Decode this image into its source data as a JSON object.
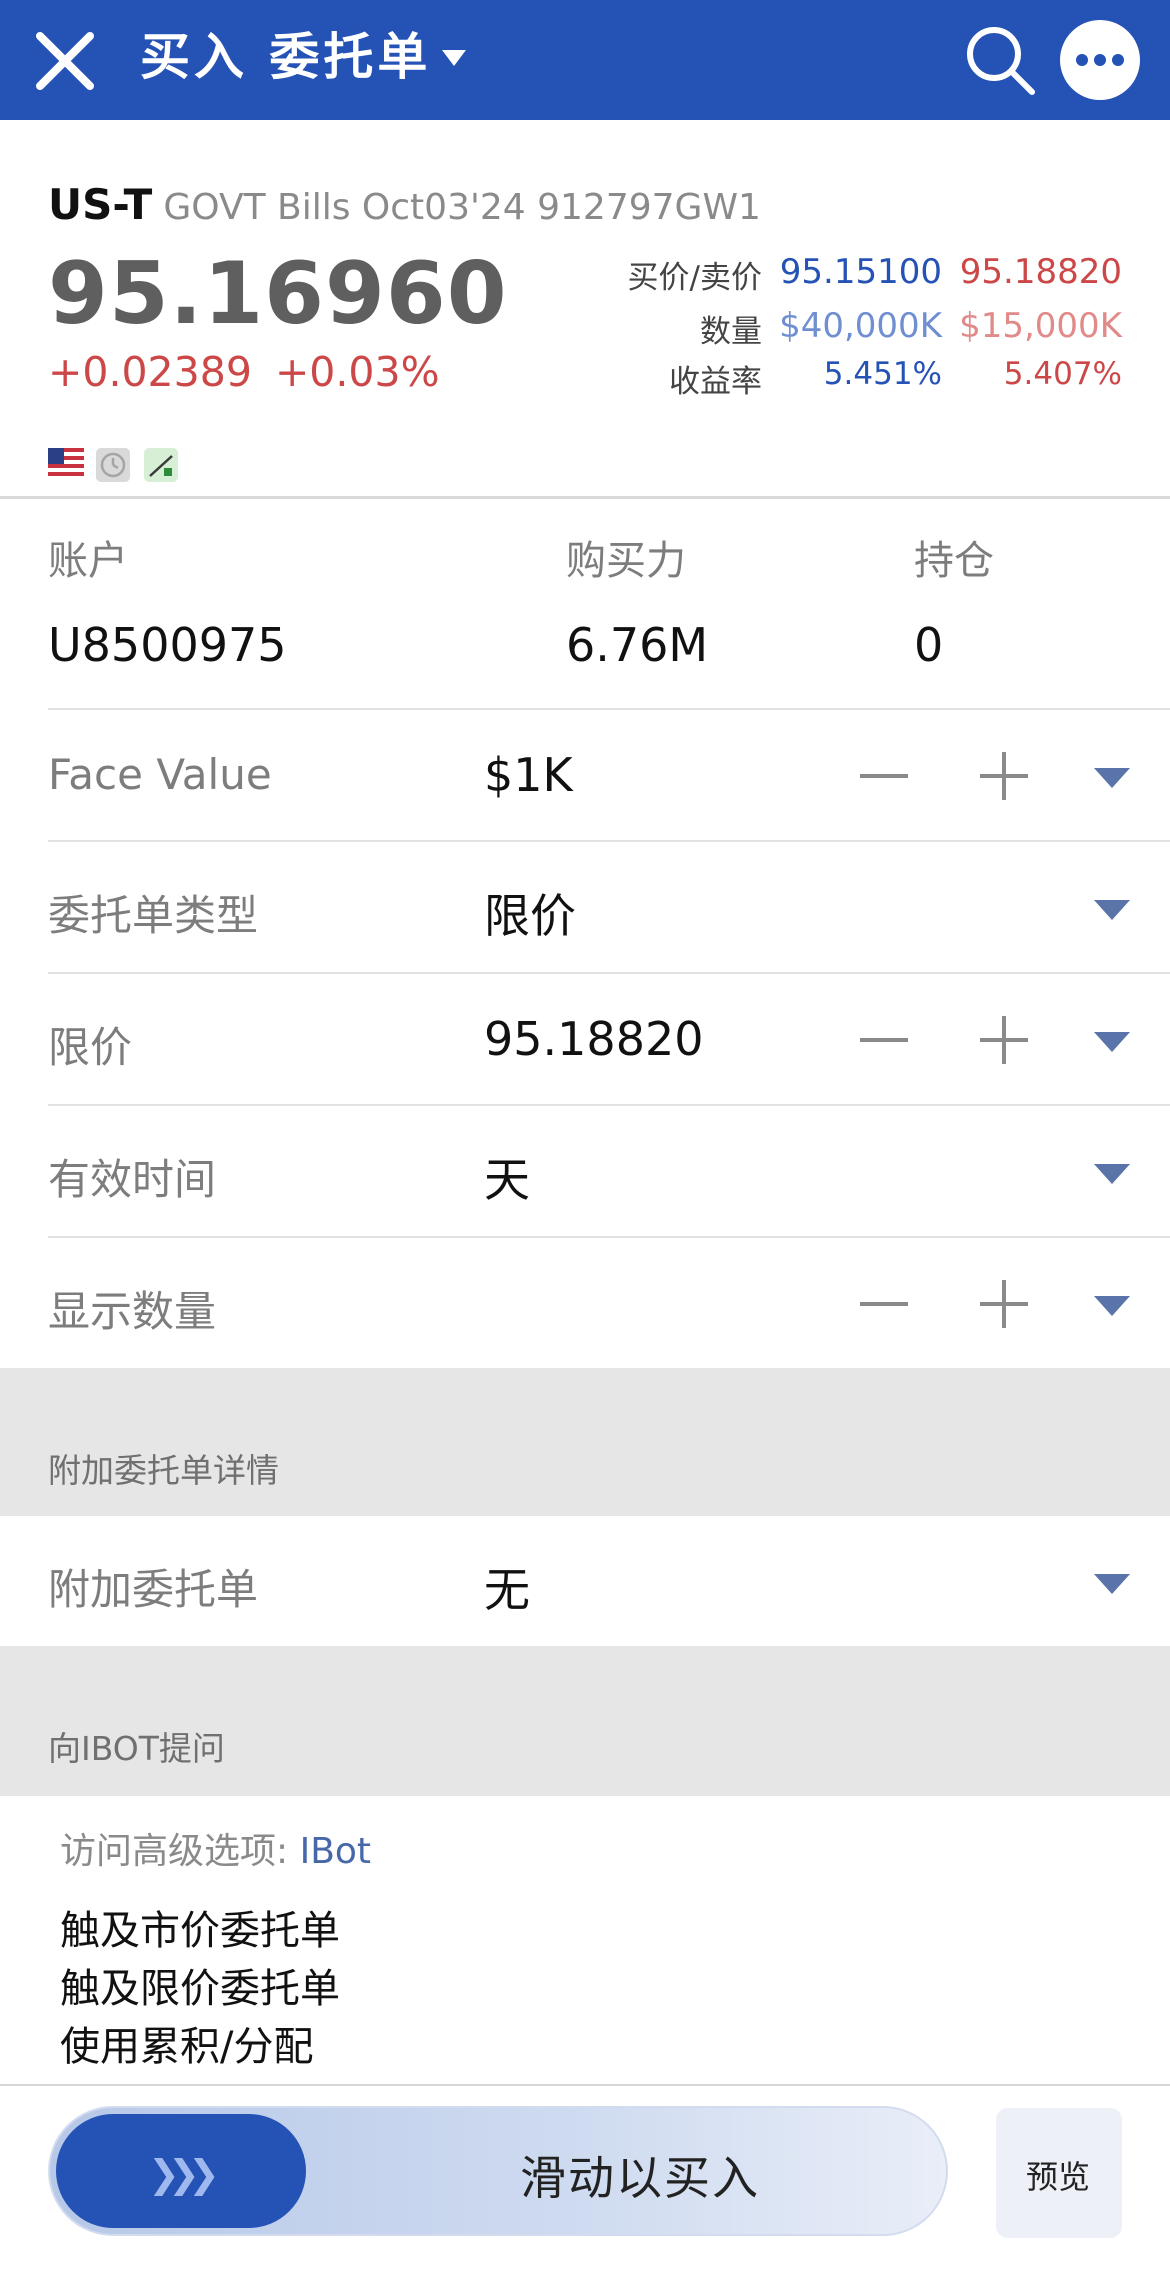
{
  "header": {
    "title": "买入 委托单",
    "icons": [
      "close-icon",
      "chevron-down-icon",
      "search-icon",
      "more-icon"
    ]
  },
  "quote": {
    "symbol": "US-T",
    "description": "GOVT Bills Oct03'24 912797GW1",
    "last_price": "95.16960",
    "change": "+0.02389",
    "change_pct": "+0.03%",
    "bid_ask_label": "买价/卖价",
    "bid": "95.15100",
    "ask": "95.18820",
    "size_label": "数量",
    "bid_size": "$40,000K",
    "ask_size": "$15,000K",
    "yield_label": "收益率",
    "bid_yield": "5.451%",
    "ask_yield": "5.407%",
    "colors": {
      "bid": "#2552b5",
      "ask": "#cc4747",
      "header": "#2552b5"
    }
  },
  "account": {
    "account_label": "账户",
    "account_value": "U8500975",
    "buying_power_label": "购买力",
    "buying_power_value": "6.76M",
    "position_label": "持仓",
    "position_value": "0"
  },
  "order": {
    "face_value_label": "Face Value",
    "face_value": "$1K",
    "order_type_label": "委托单类型",
    "order_type": "限价",
    "limit_price_label": "限价",
    "limit_price": "95.18820",
    "tif_label": "有效时间",
    "tif": "天",
    "display_size_label": "显示数量",
    "display_size": ""
  },
  "attached": {
    "section_title": "附加委托单详情",
    "label": "附加委托单",
    "value": "无"
  },
  "ibot": {
    "section_title": "向IBOT提问",
    "access_label": "访问高级选项:",
    "access_link": "IBot",
    "items": [
      "触及市价委托单",
      "触及限价委托单",
      "使用累积/分配"
    ]
  },
  "bottom": {
    "slide_label": "滑动以买入",
    "preview_label": "预览"
  }
}
